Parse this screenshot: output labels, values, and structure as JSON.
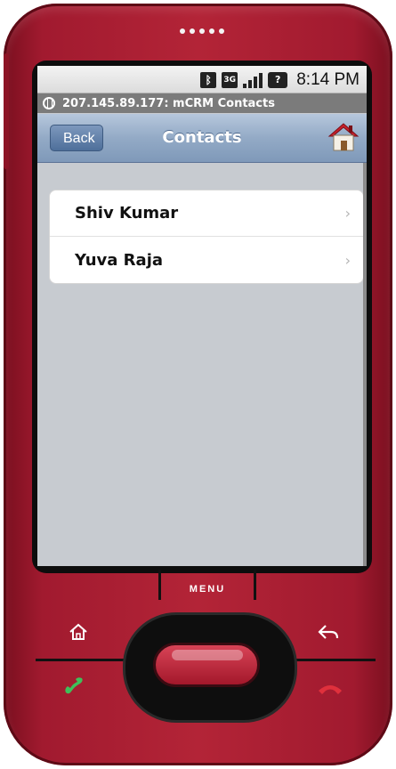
{
  "status_bar": {
    "time": "8:14 PM",
    "bluetooth_icon": "bluetooth-icon",
    "network_label": "3G",
    "signal_icon": "signal-bars-icon",
    "battery_label": "?"
  },
  "browser": {
    "title": "207.145.89.177: mCRM Contacts",
    "globe_icon": "globe-icon"
  },
  "navbar": {
    "back_label": "Back",
    "title": "Contacts",
    "home_icon": "home-icon"
  },
  "contacts": [
    {
      "name": "Shiv Kumar"
    },
    {
      "name": "Yuva Raja"
    }
  ],
  "hardware": {
    "menu_label": "MENU"
  },
  "colors": {
    "phone_body": "#a11a2f",
    "navbar": "#93aac6",
    "page_background": "#c7cbd0"
  }
}
